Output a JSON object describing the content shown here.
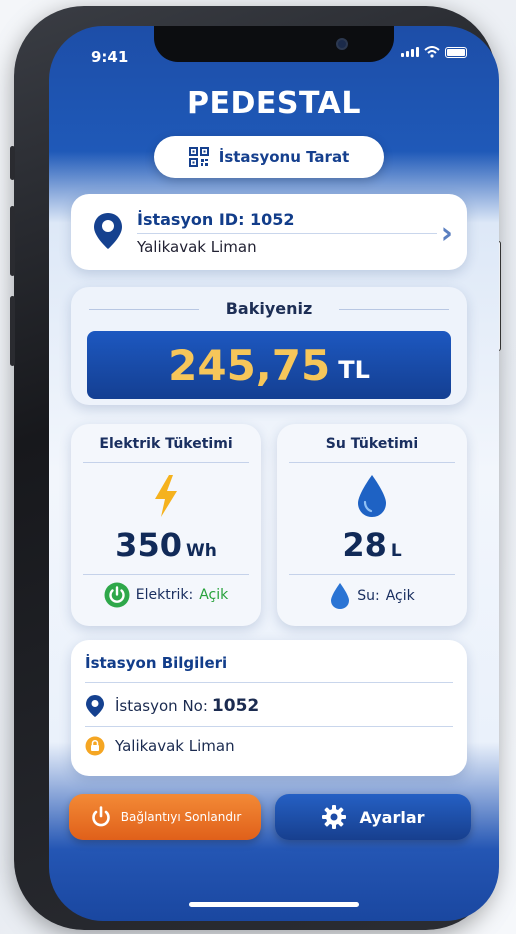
{
  "status": {
    "time": "9:41"
  },
  "app": {
    "title": "PEDESTAL"
  },
  "scan": {
    "label": "İstasyonu Tarat"
  },
  "station": {
    "id_label": "İstasyon ID: 1052",
    "location": "Yalikavak Liman"
  },
  "balance": {
    "title": "Bakiyeniz",
    "amount": "245,75",
    "currency": "TL"
  },
  "electric": {
    "title": "Elektrik Tüketimi",
    "value": "350",
    "unit": "Wh",
    "status_label": "Elektrik:",
    "status_value": "Açik"
  },
  "water": {
    "title": "Su Tüketimi",
    "value": "28",
    "unit": "L",
    "status_label": "Su:",
    "status_value": "Açik"
  },
  "info": {
    "title": "İstasyon Bilgileri",
    "station_no_label": "İstasyon No:",
    "station_no_value": "1052",
    "location": "Yalikavak Liman"
  },
  "actions": {
    "end_label": "Bağlantıyı Sonlandır",
    "settings_label": "Ayarlar"
  },
  "colors": {
    "primary": "#1d4ea8",
    "accent": "#f6c65a",
    "orange": "#e0601a",
    "green": "#28a23c"
  }
}
